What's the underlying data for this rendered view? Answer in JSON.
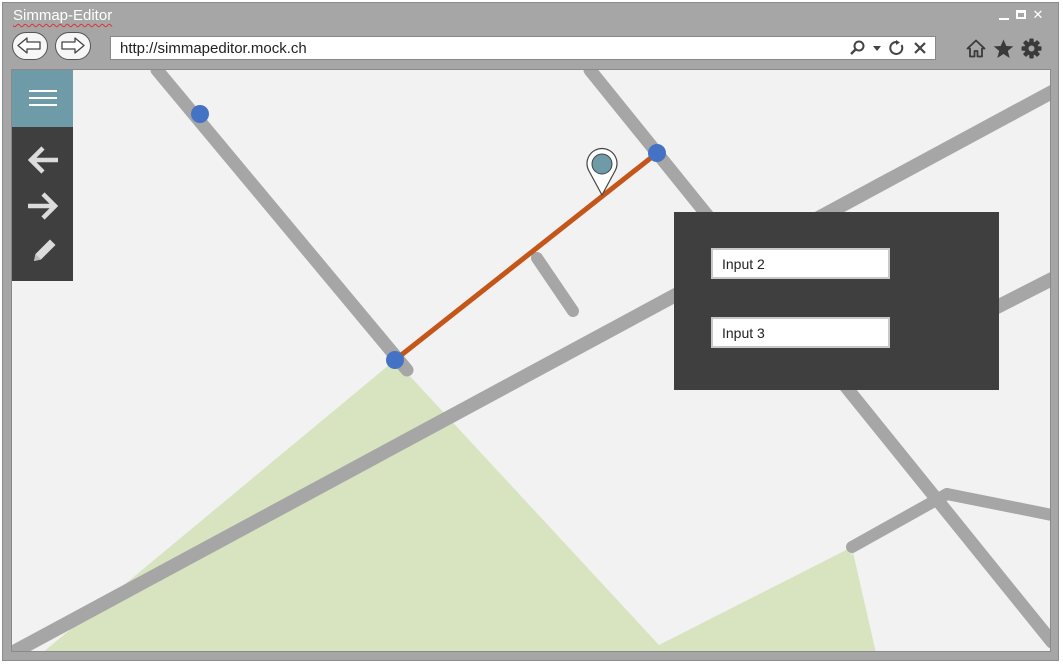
{
  "window": {
    "title": "Simmap-Editor",
    "controls": [
      "minimize-icon",
      "maximize-icon",
      "close-icon"
    ]
  },
  "browser": {
    "url": "http://simmapeditor.mock.ch",
    "nav_icons": [
      "back-arrow-icon",
      "forward-arrow-icon"
    ],
    "address_icons": [
      "search-icon",
      "dropdown-caret-icon",
      "refresh-icon",
      "stop-icon"
    ],
    "toolbar_icons": [
      "home-icon",
      "star-icon",
      "gear-icon"
    ]
  },
  "sidebar": {
    "menu_icon": "hamburger-menu-icon",
    "tools": [
      "arrow-left-icon",
      "arrow-right-icon",
      "pencil-icon"
    ]
  },
  "map": {
    "marker_icon": "map-pin-icon",
    "route_color": "#c5561a",
    "node_color": "#4472c4",
    "road_color": "#a6a6a6",
    "park_color": "#d8e4bf"
  },
  "panel": {
    "inputs": [
      {
        "value": "Input 2"
      },
      {
        "value": "Input 3"
      }
    ]
  },
  "colors": {
    "accent": "#6f9aa8",
    "toolbar_dark": "#3f3f3f",
    "chrome": "#a6a6a6"
  }
}
